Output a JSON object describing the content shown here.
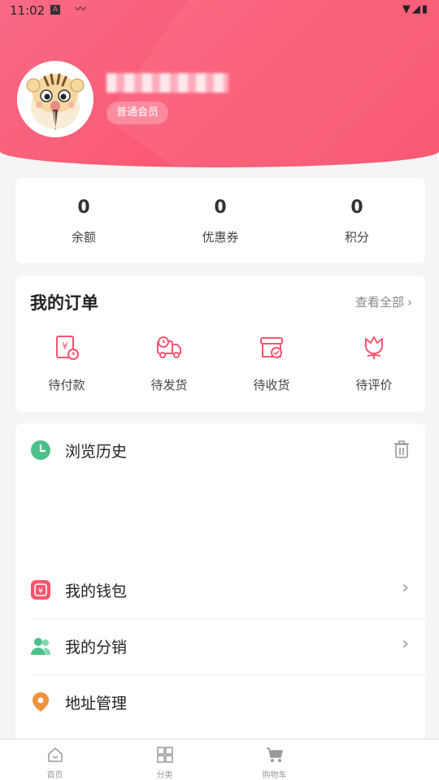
{
  "status_bar": {
    "time": "11:02"
  },
  "profile": {
    "member_level": "普通会员"
  },
  "stats": [
    {
      "value": "0",
      "label": "余额"
    },
    {
      "value": "0",
      "label": "优惠券"
    },
    {
      "value": "0",
      "label": "积分"
    }
  ],
  "orders": {
    "title": "我的订单",
    "view_all": "查看全部",
    "items": [
      {
        "label": "待付款",
        "icon": "pending-payment-icon"
      },
      {
        "label": "待发货",
        "icon": "truck-icon"
      },
      {
        "label": "待收货",
        "icon": "package-check-icon"
      },
      {
        "label": "待评价",
        "icon": "flower-icon"
      }
    ]
  },
  "menu": {
    "history_label": "浏览历史",
    "wallet_label": "我的钱包",
    "distribution_label": "我的分销",
    "address_label": "地址管理"
  },
  "tabbar": [
    {
      "label": "首页"
    },
    {
      "label": "分类"
    },
    {
      "label": "购物车"
    }
  ],
  "colors": {
    "accent": "#f8566f",
    "green": "#4cc08a",
    "orange": "#f0933d"
  }
}
